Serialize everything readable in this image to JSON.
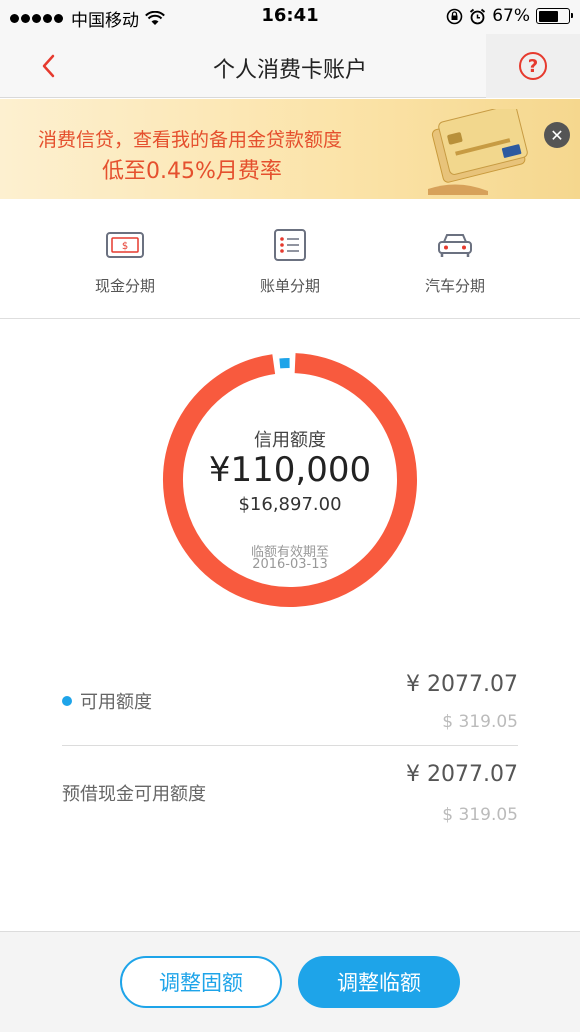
{
  "status_bar": {
    "carrier": "中国移动",
    "time": "16:41",
    "battery": "67%",
    "battery_level": 0.67
  },
  "nav": {
    "title": "个人消费卡账户",
    "help_symbol": "?"
  },
  "banner": {
    "line1": "消费信贷，查看我的备用金贷款额度",
    "line2": "低至0.45%月费率",
    "close_symbol": "✕"
  },
  "installments": [
    {
      "label": "现金分期",
      "icon": "cash-icon"
    },
    {
      "label": "账单分期",
      "icon": "bill-icon"
    },
    {
      "label": "汽车分期",
      "icon": "car-icon"
    }
  ],
  "credit": {
    "label": "信用额度",
    "amount_cny": "¥110,000",
    "amount_usd": "$16,897.00",
    "expiry_label": "临额有效期至",
    "expiry_date": "2016-03-13",
    "ring_color": "#f85a3e",
    "used_color": "#1ea4e9"
  },
  "amounts": {
    "available": {
      "label": "可用额度",
      "cny": "¥ 2077.07",
      "usd": "$ 319.05"
    },
    "cash_available": {
      "label": "预借现金可用额度",
      "cny": "¥ 2077.07",
      "usd": "$ 319.05"
    }
  },
  "buttons": {
    "fixed": "调整固额",
    "temp": "调整临额"
  },
  "colors": {
    "accent": "#1ea4e9",
    "brand_red": "#e63a2e",
    "banner_text": "#e5502e"
  }
}
